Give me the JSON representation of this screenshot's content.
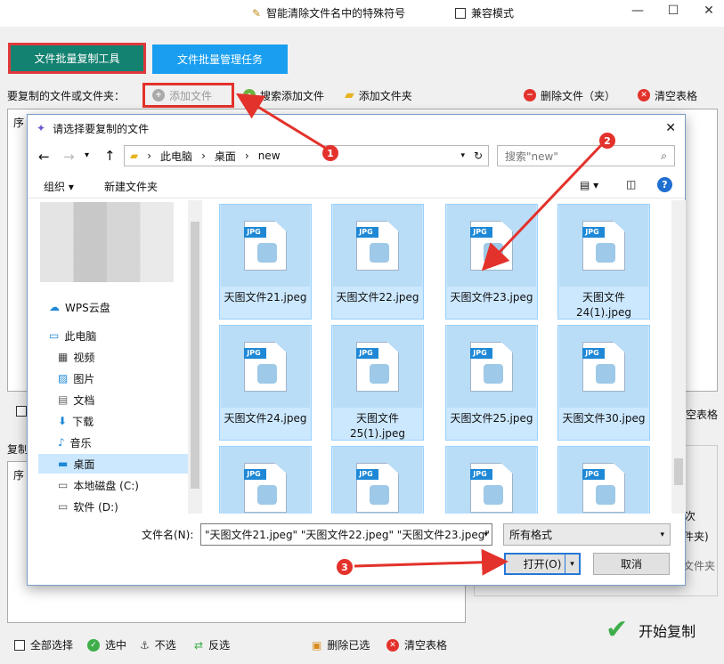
{
  "app": {
    "title_tool": "智能清除文件名中的特殊符号",
    "compat_mode": "兼容模式",
    "window_controls": [
      "—",
      "☐",
      "✕"
    ]
  },
  "tabs": [
    "文件批量复制工具",
    "文件批量管理任务"
  ],
  "toolbar": {
    "label": "要复制的文件或文件夹：",
    "add_file": "添加文件",
    "search_add": "搜索添加文件",
    "add_folder": "添加文件夹",
    "delete": "删除文件（夹）",
    "clear": "清空表格"
  },
  "main_list": {
    "col_seq": "序"
  },
  "mid_section": {
    "partial_clear": "空表格",
    "copy_label": "复制",
    "seq": "序",
    "times_suffix": "次",
    "folder_suffix": "件夹)",
    "folder_suffix2": "文件夹"
  },
  "bottom": {
    "select_all": "全部选择",
    "select": "选中",
    "deselect": "不选",
    "invert": "反选",
    "delete_selected": "删除已选",
    "clear_table": "清空表格",
    "start": "开始复制"
  },
  "dialog": {
    "title": "请选择要复制的文件",
    "path": [
      "此电脑",
      "桌面",
      "new"
    ],
    "search_placeholder": "搜索\"new\"",
    "organize": "组织",
    "new_folder": "新建文件夹",
    "nav_items": [
      {
        "label": "WPS云盘",
        "icon": "cloud-icon"
      },
      {
        "label": "此电脑",
        "icon": "computer-icon"
      },
      {
        "label": "视频",
        "icon": "video-icon"
      },
      {
        "label": "图片",
        "icon": "picture-icon"
      },
      {
        "label": "文档",
        "icon": "document-icon"
      },
      {
        "label": "下载",
        "icon": "download-icon"
      },
      {
        "label": "音乐",
        "icon": "music-icon"
      },
      {
        "label": "桌面",
        "icon": "desktop-icon"
      },
      {
        "label": "本地磁盘 (C:)",
        "icon": "drive-icon"
      },
      {
        "label": "软件 (D:)",
        "icon": "drive-icon"
      }
    ],
    "files": [
      "天图文件21.jpeg",
      "天图文件22.jpeg",
      "天图文件23.jpeg",
      "天图文件24(1).jpeg",
      "天图文件24.jpeg",
      "天图文件25(1).jpeg",
      "天图文件25.jpeg",
      "天图文件30.jpeg",
      "",
      "",
      "",
      ""
    ],
    "file_badge": "JPG",
    "filename_label": "文件名(N):",
    "filename_value": "\"天图文件21.jpeg\" \"天图文件22.jpeg\" \"天图文件23.jpeg\"",
    "format": "所有格式",
    "open": "打开(O)",
    "cancel": "取消"
  },
  "annotations": [
    "1",
    "2",
    "3"
  ],
  "colors": {
    "accent_green": "#138270",
    "accent_blue": "#1a9ff0",
    "highlight_red": "#e3322b",
    "selection": "#cce8ff"
  }
}
